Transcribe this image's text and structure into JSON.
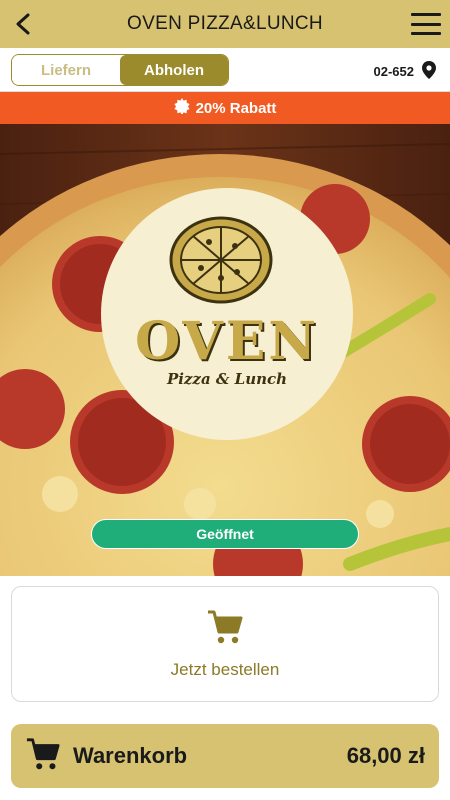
{
  "header": {
    "title": "OVEN PIZZA&LUNCH",
    "back_icon": "back-arrow-icon",
    "menu_icon": "hamburger-menu-icon",
    "background_color": "#d6c271"
  },
  "mode_toggle": {
    "options": [
      {
        "label": "Liefern",
        "active": false
      },
      {
        "label": "Abholen",
        "active": true
      }
    ],
    "accent_color": "#9c8b2c"
  },
  "contact": {
    "phone": "02-652",
    "icon": "location-pin-icon"
  },
  "promo": {
    "text": "20% Rabatt",
    "icon": "badge-icon",
    "background_color": "#f15a22"
  },
  "restaurant": {
    "logo_title": "OVEN",
    "logo_subtitle": "Pizza & Lunch",
    "status": "Geöffnet",
    "status_color": "#1fad7a"
  },
  "order_card": {
    "label": "Jetzt bestellen",
    "icon": "cart-icon"
  },
  "cart_bar": {
    "label": "Warenkorb",
    "total": "68,00 zł",
    "icon": "cart-icon"
  }
}
